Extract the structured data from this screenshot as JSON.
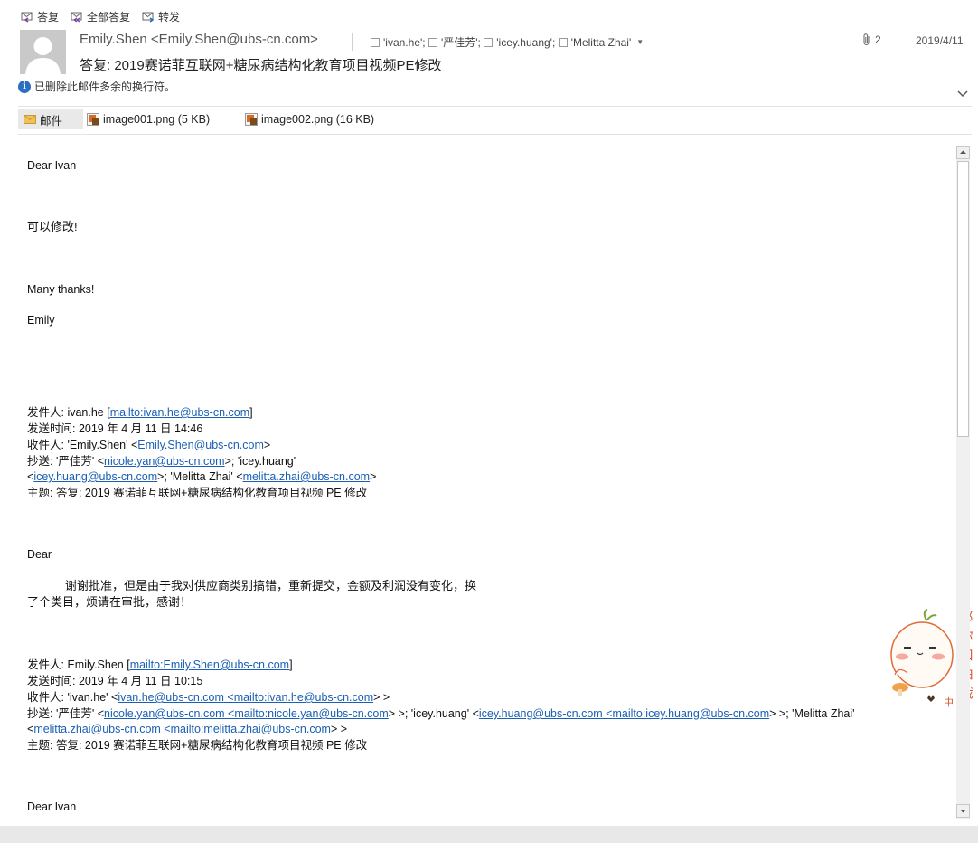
{
  "toolbar": {
    "reply": "答复",
    "reply_all": "全部答复",
    "forward": "转发"
  },
  "header": {
    "sender": "Emily.Shen <Emily.Shen@ubs-cn.com>",
    "subject": "答复: 2019赛诺菲互联网+糖尿病结构化教育项目视频PE修改",
    "recipients": [
      "'ivan.he';",
      "'严佳芳';",
      "'icey.huang';",
      "'Melitta Zhai'"
    ],
    "attachment_count": "2",
    "date": "2019/4/11",
    "info": "已删除此邮件多余的换行符。"
  },
  "attachments": [
    {
      "label": "邮件"
    },
    {
      "label": "image001.png (5 KB)"
    },
    {
      "label": "image002.png (16 KB)"
    }
  ],
  "message": {
    "greeting": "Dear Ivan",
    "reply_line": "可以修改!",
    "thanks": "Many thanks!",
    "signature": "Emily",
    "q1": {
      "from_label": "发件人: ivan.he [",
      "from_link": "mailto:ivan.he@ubs-cn.com",
      "from_end": "]",
      "sent": "发送时间: 2019 年 4 月 11 日  14:46",
      "to_label": "收件人: 'Emily.Shen' <",
      "to_link": "Emily.Shen@ubs-cn.com",
      "to_end": ">",
      "cc_label": "抄送: '严佳芳' <",
      "cc_link1": "nicole.yan@ubs-cn.com",
      "cc_mid": ">; 'icey.huang'",
      "cc2_start": "<",
      "cc_link2": "icey.huang@ubs-cn.com",
      "cc2_mid": ">; 'Melitta Zhai' <",
      "cc_link3": "melitta.zhai@ubs-cn.com",
      "cc2_end": ">",
      "subject": "主题: 答复: 2019 赛诺菲互联网+糖尿病结构化教育项目视频 PE 修改",
      "greeting": "Dear",
      "body1": "谢谢批准，但是由于我对供应商类别搞错，重新提交，金额及利润没有变化，换",
      "body2": "了个类目，烦请在审批，感谢！"
    },
    "q2": {
      "from_label": "发件人: Emily.Shen [",
      "from_link": "mailto:Emily.Shen@ubs-cn.com",
      "from_end": "]",
      "sent": "发送时间: 2019 年 4 月 11 日  10:15",
      "to_label": "收件人: 'ivan.he' <",
      "to_link": "ivan.he@ubs-cn.com <mailto:ivan.he@ubs-cn.com",
      "to_end": "> >",
      "cc_label": "抄送: '严佳芳' <",
      "cc_link1": "nicole.yan@ubs-cn.com <mailto:nicole.yan@ubs-cn.com",
      "cc_mid1": "> >; 'icey.huang' <",
      "cc_link2": "icey.huang@ubs-cn.com <mailto:icey.huang@ubs-cn.com",
      "cc_mid2": "> >; 'Melitta Zhai'",
      "cc2_start": "<",
      "cc_link3": "melitta.zhai@ubs-cn.com <mailto:melitta.zhai@ubs-cn.com",
      "cc2_end": "> >",
      "subject": "主题: 答复: 2019 赛诺菲互联网+糖尿病结构化教育项目视频 PE 修改",
      "greeting": "Dear Ivan"
    }
  },
  "sticker": {
    "text_lines": [
      "那",
      "你",
      "加",
      "油",
      "哦"
    ],
    "small_text": "中"
  },
  "colors": {
    "link": "#1a5fb4",
    "info_icon": "#2b6fc2",
    "reply_icon_accent": "#7b3fa0"
  }
}
